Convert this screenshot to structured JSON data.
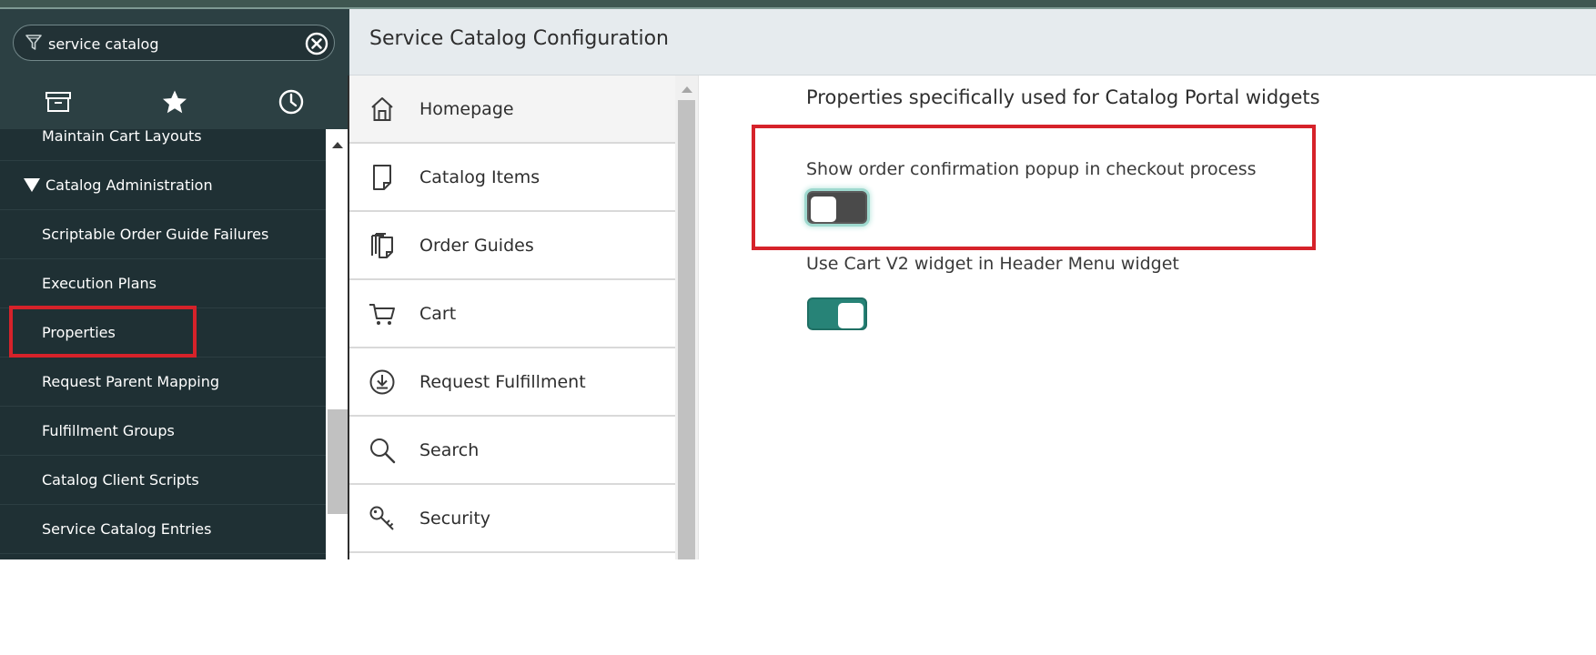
{
  "filter": {
    "value": "service catalog",
    "placeholder": ""
  },
  "nav_tabs": [
    {
      "icon": "archive-icon"
    },
    {
      "icon": "star-icon"
    },
    {
      "icon": "clock-icon"
    }
  ],
  "nav_items": [
    {
      "label": "Maintain Cart Layouts"
    },
    {
      "label": "Catalog Administration",
      "expanded": true
    },
    {
      "label": "Scriptable Order Guide Failures"
    },
    {
      "label": "Execution Plans"
    },
    {
      "label": "Properties"
    },
    {
      "label": "Request Parent Mapping"
    },
    {
      "label": "Fulfillment Groups"
    },
    {
      "label": "Catalog Client Scripts"
    },
    {
      "label": "Service Catalog Entries"
    }
  ],
  "header": {
    "title": "Service Catalog Configuration"
  },
  "catalog_menu": [
    {
      "label": "Homepage",
      "icon": "home-icon",
      "active": true
    },
    {
      "label": "Catalog Items",
      "icon": "document-icon"
    },
    {
      "label": "Order Guides",
      "icon": "documents-icon"
    },
    {
      "label": "Cart",
      "icon": "cart-icon"
    },
    {
      "label": "Request Fulfillment",
      "icon": "download-icon"
    },
    {
      "label": "Search",
      "icon": "search-icon"
    },
    {
      "label": "Security",
      "icon": "key-icon"
    }
  ],
  "content": {
    "section_title": "Properties specifically used for Catalog Portal widgets",
    "properties": [
      {
        "label": "Show order confirmation popup in checkout process",
        "enabled": false
      },
      {
        "label": "Use Cart V2 widget in Header Menu widget",
        "enabled": true
      }
    ]
  },
  "colors": {
    "nav_bg": "#1f3034",
    "accent_toggle_on": "#278377",
    "highlight": "#d6222a"
  }
}
